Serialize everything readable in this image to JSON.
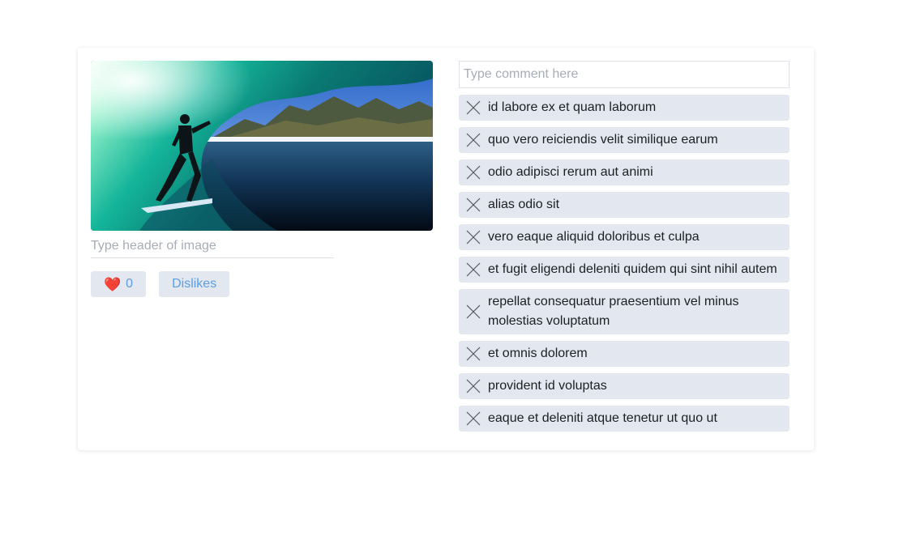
{
  "image": {
    "alt": "Surfer riding inside a barrel wave with mountains in the background",
    "header_placeholder": "Type header of image"
  },
  "reactions": {
    "heart_icon": "❤️",
    "likes_count": "0",
    "dislikes_label": "Dislikes"
  },
  "comment_input": {
    "placeholder": "Type comment here"
  },
  "comments": [
    "id labore ex et quam laborum",
    "quo vero reiciendis velit similique earum",
    "odio adipisci rerum aut animi",
    "alias odio sit",
    "vero eaque aliquid doloribus et culpa",
    "et fugit eligendi deleniti quidem qui sint nihil autem",
    "repellat consequatur praesentium vel minus molestias voluptatum",
    "et omnis dolorem",
    "provident id voluptas",
    "eaque et deleniti atque tenetur ut quo ut"
  ],
  "colors": {
    "button_bg": "#e2e7f0",
    "button_text": "#5b9ee6",
    "comment_bg": "#e2e7f0"
  }
}
